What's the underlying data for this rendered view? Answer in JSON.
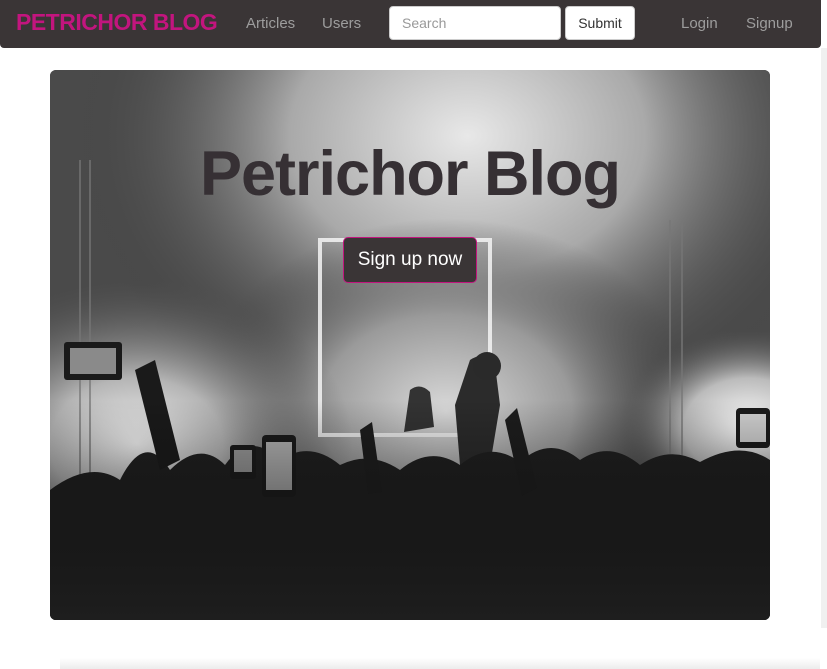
{
  "navbar": {
    "brand": "PETRICHOR BLOG",
    "links": [
      "Articles",
      "Users"
    ],
    "search": {
      "placeholder": "Search",
      "value": ""
    },
    "submit_label": "Submit",
    "auth_links": [
      "Login",
      "Signup"
    ]
  },
  "hero": {
    "title": "Petrichor Blog",
    "cta_label": "Sign up now",
    "image": "concert-crowd-photo"
  },
  "colors": {
    "accent": "#c2157e",
    "navbar_bg": "#3a3536",
    "nav_link": "#9d9d9d"
  }
}
